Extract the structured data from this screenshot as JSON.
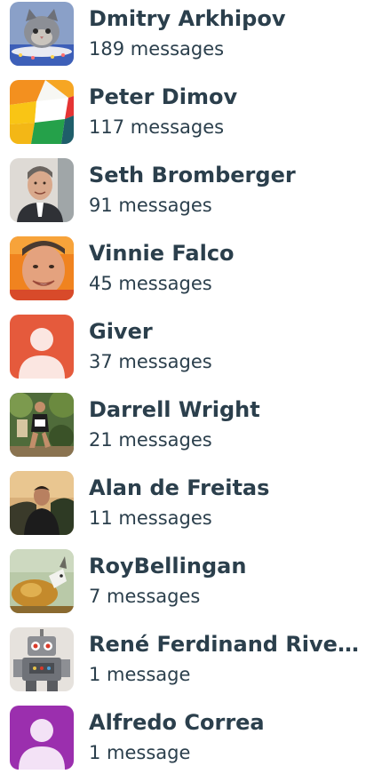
{
  "participants": [
    {
      "name": "Dmitry Arkhipov",
      "count": "189 messages",
      "avatar": "cat-photo-avatar"
    },
    {
      "name": "Peter Dimov",
      "count": "117 messages",
      "avatar": "color-blocks-avatar"
    },
    {
      "name": "Seth Bromberger",
      "count": "91 messages",
      "avatar": "man-portrait-avatar"
    },
    {
      "name": "Vinnie Falco",
      "count": "45 messages",
      "avatar": "man-face-avatar"
    },
    {
      "name": "Giver",
      "count": "37 messages",
      "avatar": "default-user-avatar",
      "color": "#e55a3c"
    },
    {
      "name": "Darrell Wright",
      "count": "21 messages",
      "avatar": "runner-photo-avatar"
    },
    {
      "name": "Alan de Freitas",
      "count": "11 messages",
      "avatar": "man-outdoor-avatar"
    },
    {
      "name": "RoyBellingan",
      "count": "7 messages",
      "avatar": "goat-photo-avatar"
    },
    {
      "name": "René Ferdinand Rivera Morell",
      "count": "1 message",
      "avatar": "robot-toy-avatar"
    },
    {
      "name": "Alfredo Correa",
      "count": "1 message",
      "avatar": "default-user-avatar",
      "color": "#9b2fae"
    }
  ]
}
